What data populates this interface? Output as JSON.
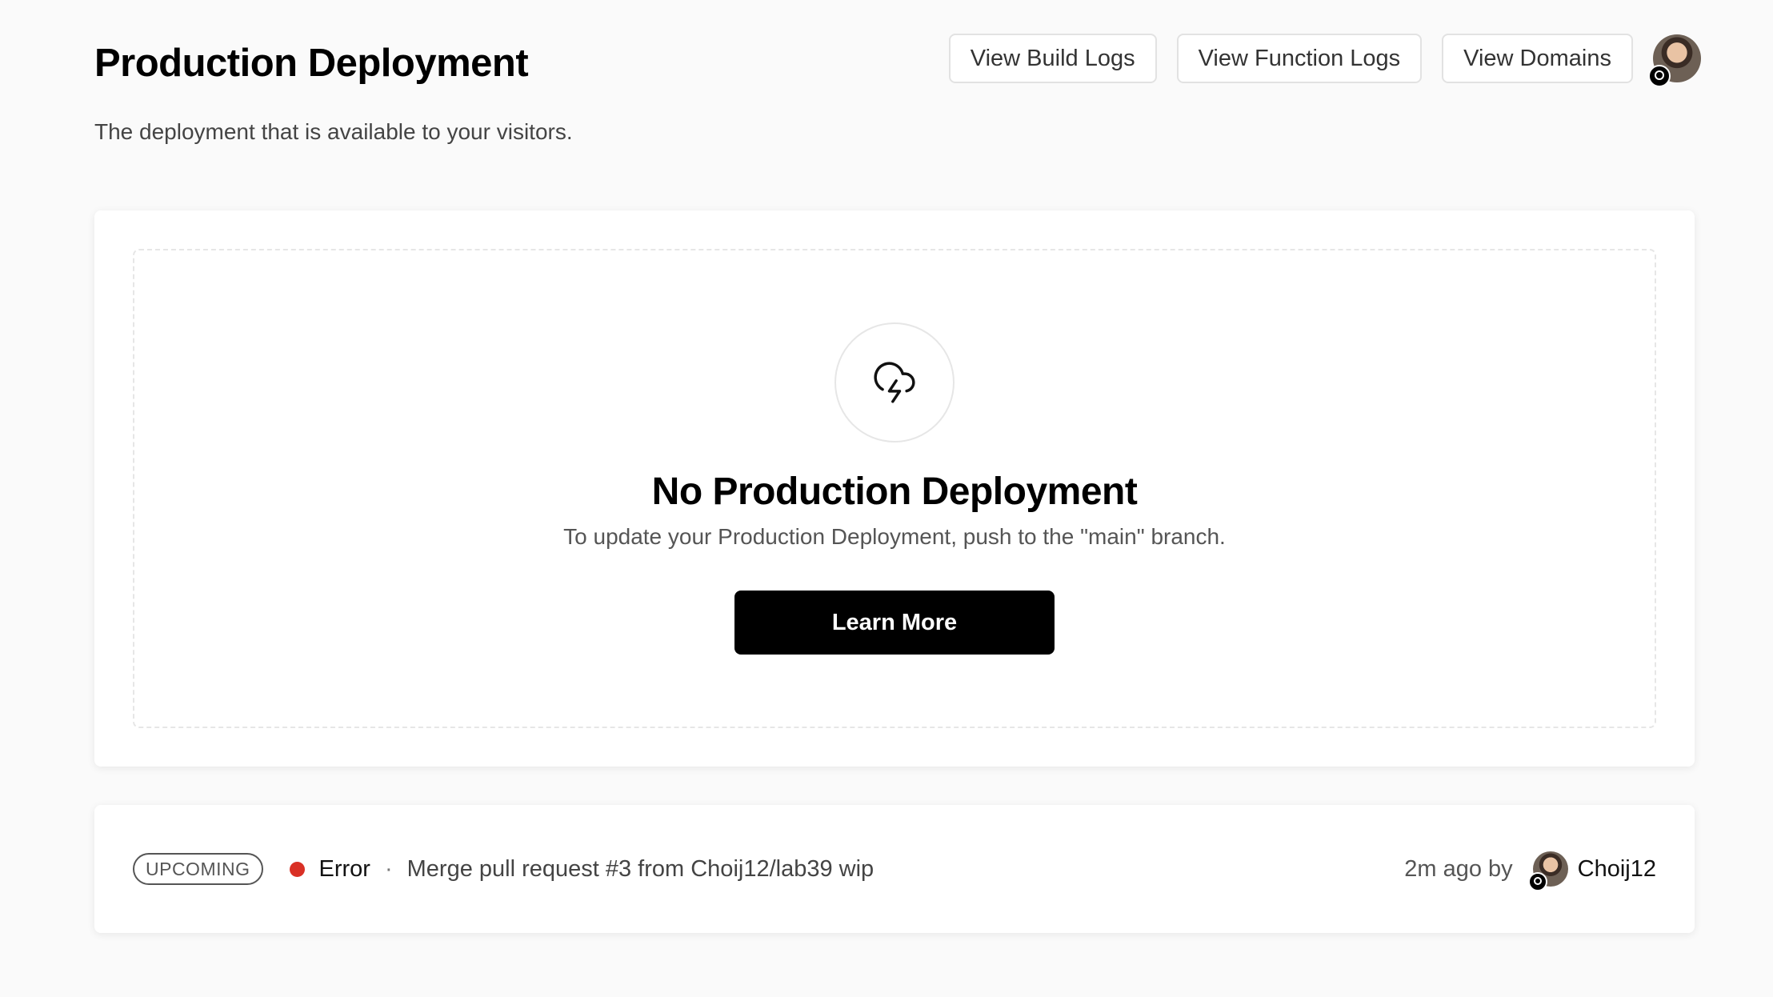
{
  "header": {
    "title": "Production Deployment",
    "subtitle": "The deployment that is available to your visitors."
  },
  "actions": {
    "build_logs": "View Build Logs",
    "function_logs": "View Function Logs",
    "domains": "View Domains"
  },
  "empty_state": {
    "icon": "cloud-lightning-icon",
    "title": "No Production Deployment",
    "description": "To update your Production Deployment, push to the \"main\" branch.",
    "button": "Learn More"
  },
  "upcoming": {
    "badge": "UPCOMING",
    "status": "Error",
    "status_color": "#d93025",
    "separator": "·",
    "commit_message": "Merge pull request #3 from Choij12/lab39 wip",
    "time": "2m ago by",
    "author": "Choij12"
  }
}
